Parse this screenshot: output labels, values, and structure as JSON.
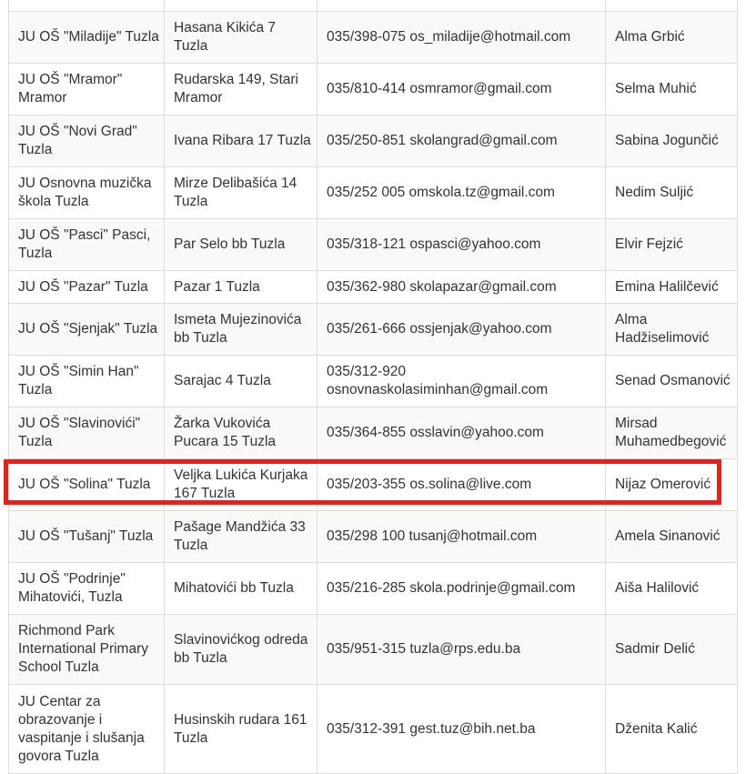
{
  "table": {
    "rows": [
      {
        "name": "",
        "address": "",
        "contact": "",
        "principal": ""
      },
      {
        "name": "JU OŠ \"Miladije\" Tuzla",
        "address": "Hasana Kikića 7 Tuzla",
        "contact": "035/398-075 os_miladije@hotmail.com",
        "principal": "Alma Grbić"
      },
      {
        "name": "JU OŠ \"Mramor\" Mramor",
        "address": "Rudarska 149, Stari Mramor",
        "contact": "035/810-414 osmramor@gmail.com",
        "principal": "Selma Muhić"
      },
      {
        "name": "JU OŠ \"Novi Grad\" Tuzla",
        "address": "Ivana Ribara 17 Tuzla",
        "contact": "035/250-851 skolangrad@gmail.com",
        "principal": "Sabina Jogunčić"
      },
      {
        "name": "JU Osnovna muzička škola Tuzla",
        "address": "Mirze Delibašića 14 Tuzla",
        "contact": "035/252 005 omskola.tz@gmail.com",
        "principal": "Nedim Suljić"
      },
      {
        "name": "JU OŠ \"Pasci\" Pasci, Tuzla",
        "address": "Par Selo bb Tuzla",
        "contact": "035/318-121 ospasci@yahoo.com",
        "principal": "Elvir Fejzić"
      },
      {
        "name": "JU OŠ \"Pazar\" Tuzla",
        "address": "Pazar 1 Tuzla",
        "contact": "035/362-980 skolapazar@gmail.com",
        "principal": "Emina Halilčević"
      },
      {
        "name": "JU OŠ \"Sjenjak\" Tuzla",
        "address": "Ismeta Mujezinovića bb Tuzla",
        "contact": "035/261-666 ossjenjak@yahoo.com",
        "principal": "Alma Hadžiselimović"
      },
      {
        "name": "JU OŠ \"Simin Han\" Tuzla",
        "address": "Sarajac 4 Tuzla",
        "contact": "035/312-920 osnovnaskolasiminhan@gmail.com",
        "principal": "Senad Osmanović"
      },
      {
        "name": "JU OŠ \"Slavinovići\" Tuzla",
        "address": "Žarka Vukovića Pucara 15 Tuzla",
        "contact": "035/364-855 osslavin@yahoo.com",
        "principal": "Mirsad Muhamedbegović"
      },
      {
        "name": "JU OŠ \"Solina\" Tuzla",
        "address": "Veljka Lukića Kurjaka 167 Tuzla",
        "contact": "035/203-355 os.solina@live.com",
        "principal": "Nijaz Omerović"
      },
      {
        "name": "JU OŠ \"Tušanj\" Tuzla",
        "address": "Pašage Mandžića 33 Tuzla",
        "contact": "035/298 100 tusanj@hotmail.com",
        "principal": "Amela Sinanović"
      },
      {
        "name": "JU OŠ \"Podrinje\" Mihatovići, Tuzla",
        "address": "Mihatovići bb Tuzla",
        "contact": "035/216-285 skola.podrinje@gmail.com",
        "principal": "Aiša Halilović"
      },
      {
        "name": "Richmond Park International Primary School Tuzla",
        "address": "Slavinovićkog odreda bb Tuzla",
        "contact": "035/951-315 tuzla@rps.edu.ba",
        "principal": "Sadmir Delić"
      },
      {
        "name": "JU Centar za obrazovanje i vaspitanje i slušanja govora Tuzla",
        "address": "Husinskih rudara 161 Tuzla",
        "contact": "035/312-391 gest.tuz@bih.net.ba",
        "principal": "Dženita Kalić"
      }
    ]
  },
  "highlight": {
    "row": 10,
    "color": "#e8201c"
  }
}
